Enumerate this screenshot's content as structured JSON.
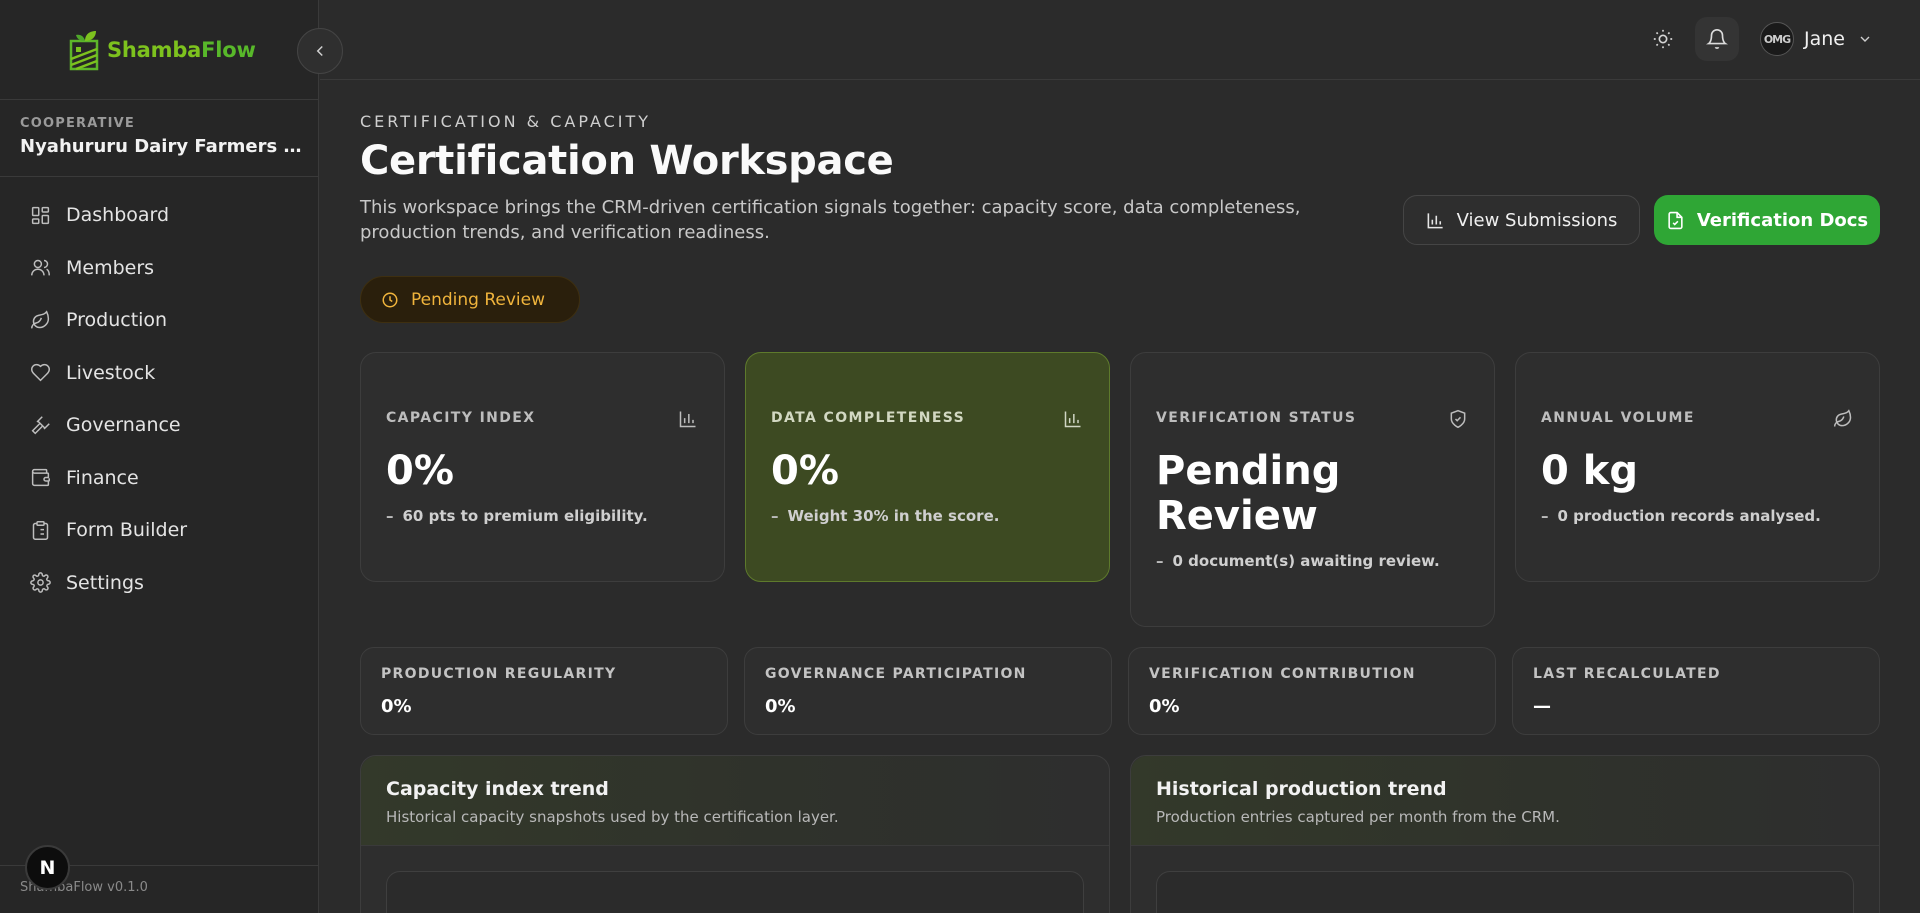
{
  "brand": {
    "name_a": "Shamba",
    "name_b": "Flow"
  },
  "cooperative": {
    "label": "COOPERATIVE",
    "name": "Nyahururu Dairy Farmers C..."
  },
  "nav": [
    {
      "label": "Dashboard",
      "icon": "dashboard-icon"
    },
    {
      "label": "Members",
      "icon": "users-icon"
    },
    {
      "label": "Production",
      "icon": "leaf-icon"
    },
    {
      "label": "Livestock",
      "icon": "heart-icon"
    },
    {
      "label": "Governance",
      "icon": "gavel-icon"
    },
    {
      "label": "Finance",
      "icon": "wallet-icon"
    },
    {
      "label": "Form Builder",
      "icon": "clipboard-icon"
    },
    {
      "label": "Settings",
      "icon": "gear-icon"
    }
  ],
  "footer": {
    "version": "ShambaFlow v0.1.0",
    "badge": "N"
  },
  "topbar": {
    "user_name": "Jane",
    "avatar_text": "OMG"
  },
  "header": {
    "eyebrow": "CERTIFICATION & CAPACITY",
    "title": "Certification Workspace",
    "description": "This workspace brings the CRM-driven certification signals together: capacity score, data completeness, production trends, and verification readiness.",
    "btn_submissions": "View Submissions",
    "btn_docs": "Verification Docs",
    "status_badge": "Pending Review"
  },
  "stats": [
    {
      "label": "CAPACITY INDEX",
      "value": "0%",
      "sub": "60 pts to premium eligibility.",
      "icon": "bar-chart-icon"
    },
    {
      "label": "DATA COMPLETENESS",
      "value": "0%",
      "sub": "Weight 30% in the score.",
      "icon": "bar-chart-icon"
    },
    {
      "label": "VERIFICATION STATUS",
      "value_line1": "Pending",
      "value_line2": "Review",
      "sub": "0 document(s) awaiting review.",
      "icon": "shield-check-icon"
    },
    {
      "label": "ANNUAL VOLUME",
      "value": "0 kg",
      "sub": "0 production records analysed.",
      "icon": "leaf-icon"
    }
  ],
  "metrics": [
    {
      "label": "PRODUCTION REGULARITY",
      "value": "0%"
    },
    {
      "label": "GOVERNANCE PARTICIPATION",
      "value": "0%"
    },
    {
      "label": "VERIFICATION CONTRIBUTION",
      "value": "0%"
    },
    {
      "label": "LAST RECALCULATED",
      "value": "—"
    }
  ],
  "panels": [
    {
      "title": "Capacity index trend",
      "subtitle": "Historical capacity snapshots used by the certification layer."
    },
    {
      "title": "Historical production trend",
      "subtitle": "Production entries captured per month from the CRM."
    }
  ],
  "colors": {
    "accent": "#2fa635",
    "pending": "#f0b43c",
    "brand_green": "#7dc21e"
  }
}
